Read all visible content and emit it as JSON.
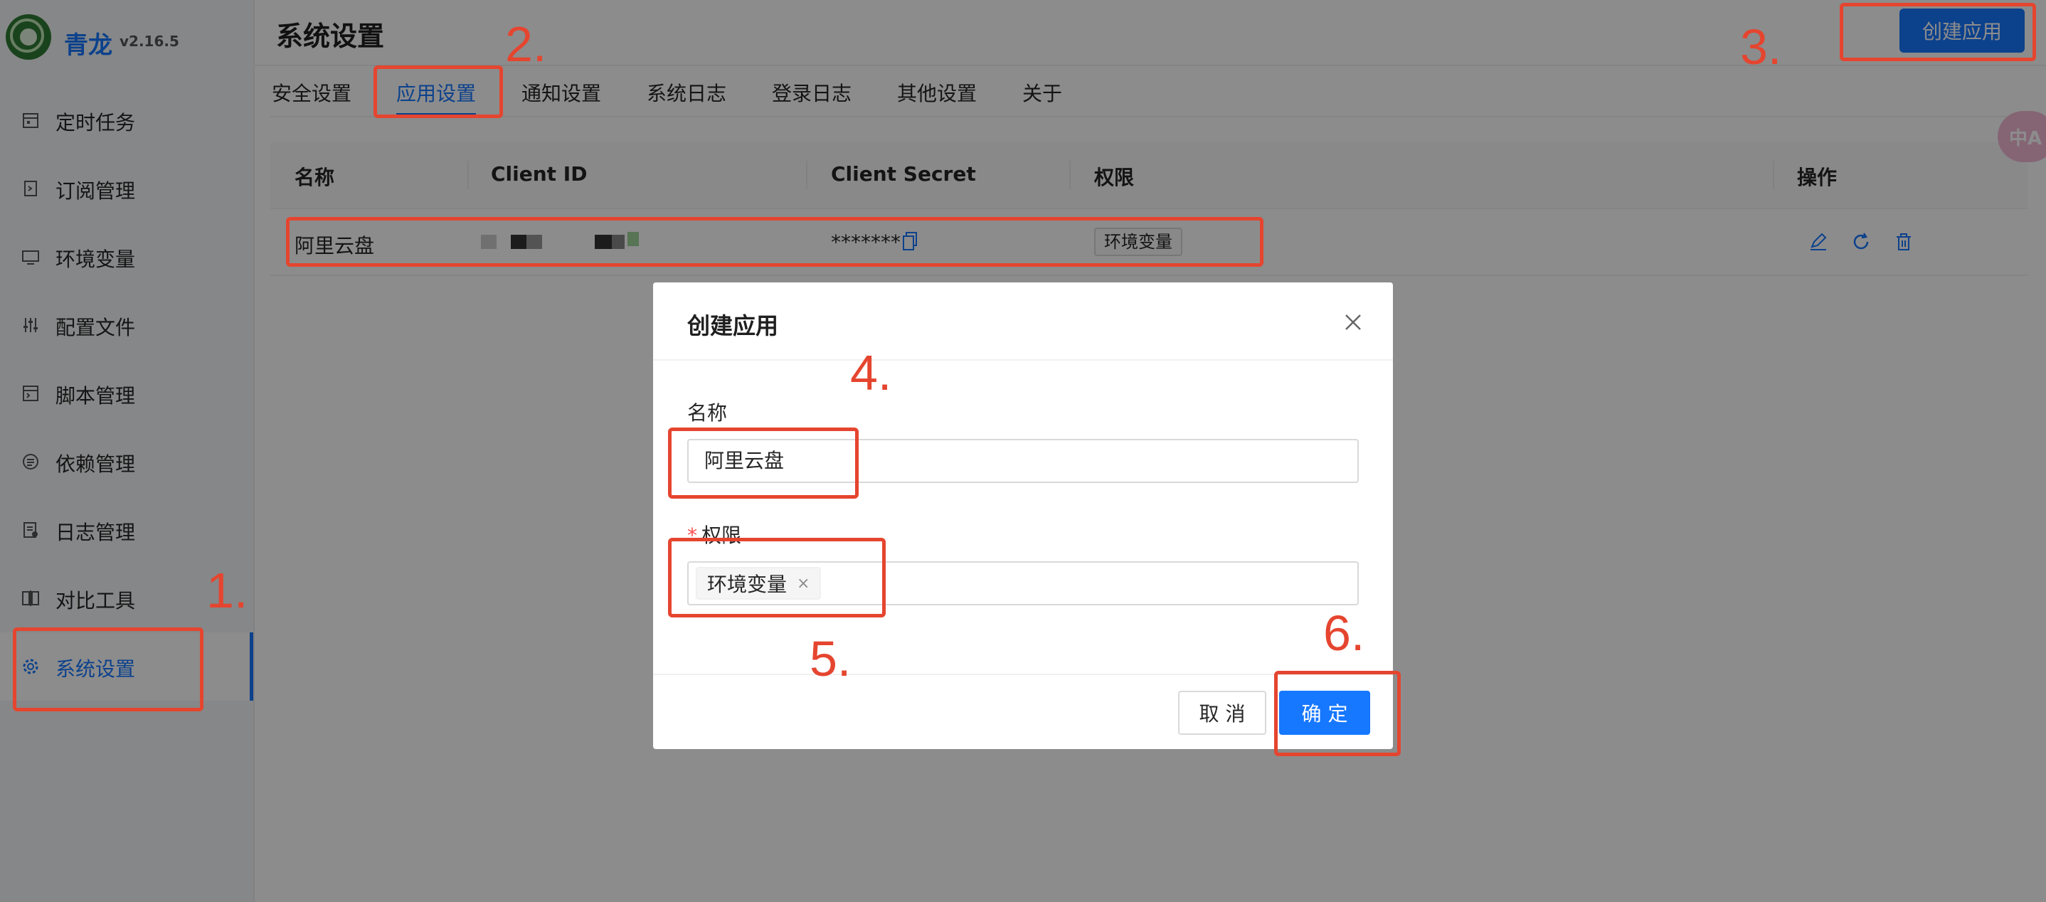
{
  "app": {
    "name": "青龙",
    "version": "v2.16.5"
  },
  "sidebar": {
    "items": [
      {
        "label": "定时任务",
        "icon": "calendar-icon"
      },
      {
        "label": "订阅管理",
        "icon": "subscription-icon"
      },
      {
        "label": "环境变量",
        "icon": "monitor-icon"
      },
      {
        "label": "配置文件",
        "icon": "sliders-icon"
      },
      {
        "label": "脚本管理",
        "icon": "code-file-icon"
      },
      {
        "label": "依赖管理",
        "icon": "list-circle-icon"
      },
      {
        "label": "日志管理",
        "icon": "log-file-icon"
      },
      {
        "label": "对比工具",
        "icon": "diff-icon"
      },
      {
        "label": "系统设置",
        "icon": "gear-icon",
        "active": true
      }
    ]
  },
  "header": {
    "title": "系统设置",
    "create_button": "创建应用"
  },
  "tabs": [
    {
      "label": "安全设置"
    },
    {
      "label": "应用设置",
      "active": true
    },
    {
      "label": "通知设置"
    },
    {
      "label": "系统日志"
    },
    {
      "label": "登录日志"
    },
    {
      "label": "其他设置"
    },
    {
      "label": "关于"
    }
  ],
  "table": {
    "columns": [
      "名称",
      "Client ID",
      "Client Secret",
      "权限",
      "操作"
    ],
    "rows": [
      {
        "name": "阿里云盘",
        "client_id": "(redacted)",
        "client_secret": "*******",
        "permissions": [
          "环境变量"
        ],
        "actions": [
          "edit-icon",
          "refresh-icon",
          "delete-icon"
        ]
      }
    ]
  },
  "modal": {
    "title": "创建应用",
    "name_label": "名称",
    "name_value": "阿里云盘",
    "permission_label": "权限",
    "required_mark": "*",
    "permission_tags": [
      "环境变量"
    ],
    "tag_remove_glyph": "×",
    "close_glyph": "×",
    "cancel": "取 消",
    "ok": "确 定"
  },
  "translate_button": "中A",
  "annotations": {
    "step1": "1.",
    "step2": "2.",
    "step3": "3.",
    "step4": "4.",
    "step5": "5.",
    "step6": "6.",
    "color": "#e5452f"
  },
  "colors": {
    "primary": "#1677ff",
    "annotation": "#e5452f",
    "danger": "#ff4d4f"
  }
}
